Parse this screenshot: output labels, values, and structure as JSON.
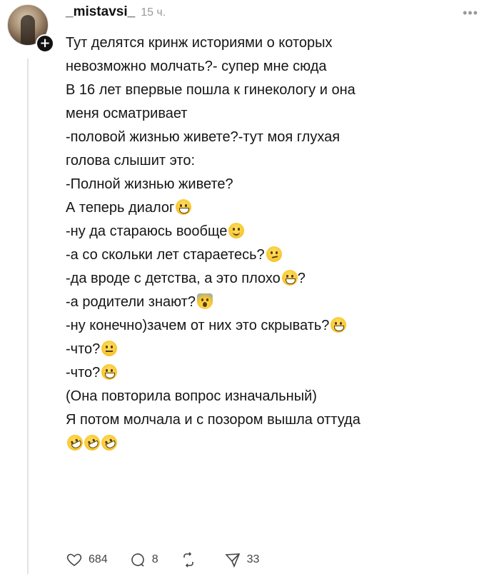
{
  "post": {
    "username": "_mistavsi_",
    "timestamp": "15 ч.",
    "more_label": "•••",
    "follow_label": "+",
    "lines": [
      {
        "text": "Тут делятся кринж историями о которых",
        "emoji": []
      },
      {
        "text": "невозможно молчать?- супер мне сюда",
        "emoji": []
      },
      {
        "text": "В 16 лет впервые пошла к гинекологу и она",
        "emoji": []
      },
      {
        "text": "меня осматривает",
        "emoji": []
      },
      {
        "text": "-половой жизнью живете?-тут моя глухая",
        "emoji": []
      },
      {
        "text": "голова слышит это:",
        "emoji": []
      },
      {
        "text": "-Полной жизнью живете?",
        "emoji": []
      },
      {
        "text": "А теперь диалог",
        "emoji": [
          "grin"
        ]
      },
      {
        "text": "-ну да стараюсь вообще",
        "emoji": [
          "smile"
        ]
      },
      {
        "text": "-а со скольки лет стараетесь?",
        "emoji": [
          "think"
        ]
      },
      {
        "text": "-да вроде с детства, а это плохо",
        "emoji": [
          "grin"
        ],
        "suffix": "?"
      },
      {
        "text": "-а родители знают?",
        "emoji": [
          "fear"
        ]
      },
      {
        "text": "-ну конечно)зачем от них это скрывать?",
        "emoji": [
          "grin"
        ]
      },
      {
        "text": "-что?",
        "emoji": [
          "neutral"
        ]
      },
      {
        "text": "-что?",
        "emoji": [
          "grin"
        ]
      },
      {
        "text": "(Она повторила вопрос изначальный)",
        "emoji": []
      },
      {
        "text": "Я потом молчала и с позором вышла оттуда",
        "emoji": []
      },
      {
        "text": "",
        "emoji": [
          "rofl",
          "rofl",
          "rofl"
        ]
      }
    ]
  },
  "actions": {
    "like_count": "684",
    "comment_count": "8",
    "repost_count": "",
    "share_count": "33",
    "like_icon": "heart-icon",
    "comment_icon": "comment-bubble-icon",
    "repost_icon": "repost-icon",
    "share_icon": "send-icon"
  }
}
